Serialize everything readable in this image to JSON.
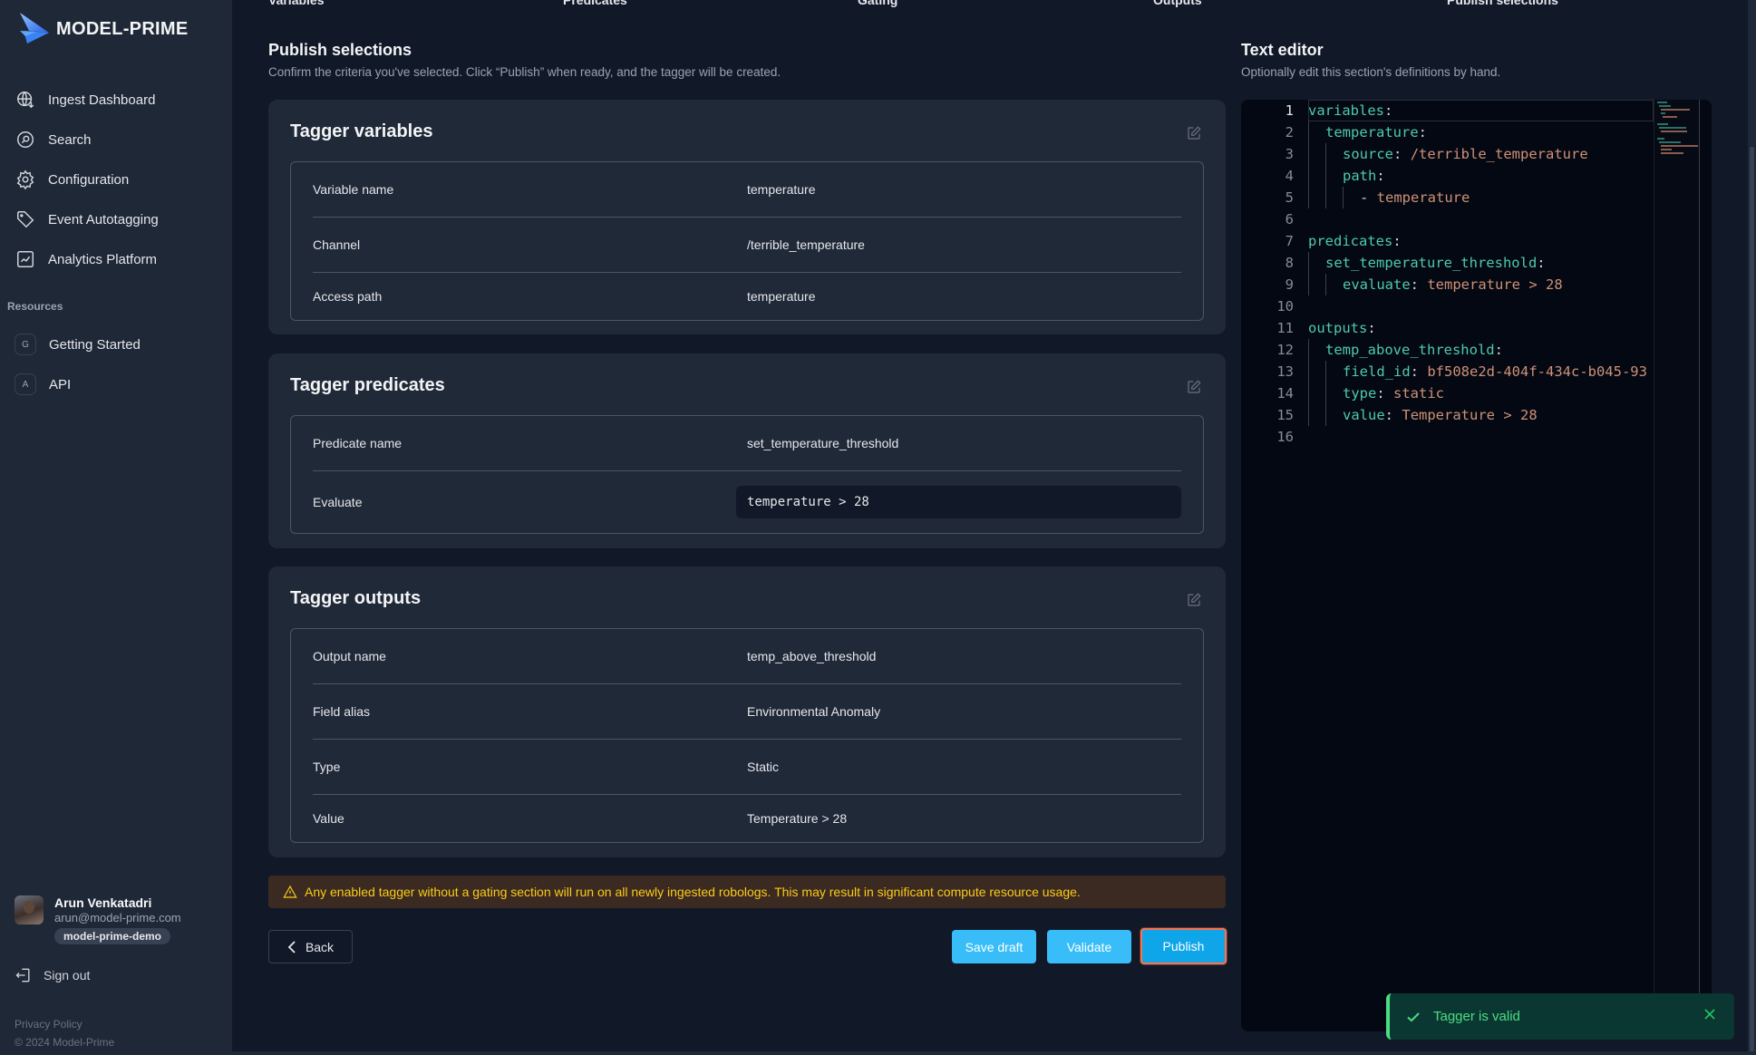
{
  "app": {
    "brand": "MODEL-PRIME"
  },
  "sidebar": {
    "nav": [
      {
        "label": "Ingest Dashboard",
        "icon": "globe-download-icon"
      },
      {
        "label": "Search",
        "icon": "search-icon"
      },
      {
        "label": "Configuration",
        "icon": "gear-icon"
      },
      {
        "label": "Event Autotagging",
        "icon": "tag-icon"
      },
      {
        "label": "Analytics Platform",
        "icon": "chart-icon"
      }
    ],
    "resources_label": "Resources",
    "resources": [
      {
        "badge": "G",
        "label": "Getting Started"
      },
      {
        "badge": "A",
        "label": "API"
      }
    ],
    "user": {
      "name": "Arun Venkatadri",
      "email": "arun@model-prime.com",
      "org": "model-prime-demo"
    },
    "sign_out": "Sign out",
    "privacy": "Privacy Policy",
    "copyright": "© 2024 Model-Prime"
  },
  "stepper": [
    "Variables",
    "Predicates",
    "Gating",
    "Outputs",
    "Publish selections"
  ],
  "main": {
    "title": "Publish selections",
    "subtitle": "Confirm the criteria you've selected. Click “Publish” when ready, and the tagger will be created.",
    "cards": [
      {
        "title": "Tagger variables",
        "rows": [
          {
            "key": "Variable name",
            "value": "temperature"
          },
          {
            "key": "Channel",
            "value": "/terrible_temperature"
          },
          {
            "key": "Access path",
            "value": "temperature"
          }
        ]
      },
      {
        "title": "Tagger predicates",
        "rows": [
          {
            "key": "Predicate name",
            "value": "set_temperature_threshold"
          },
          {
            "key": "Evaluate",
            "value": "temperature > 28",
            "code": true
          }
        ]
      },
      {
        "title": "Tagger outputs",
        "rows": [
          {
            "key": "Output name",
            "value": "temp_above_threshold"
          },
          {
            "key": "Field alias",
            "value": "Environmental Anomaly"
          },
          {
            "key": "Type",
            "value": "Static"
          },
          {
            "key": "Value",
            "value": "Temperature > 28"
          }
        ]
      }
    ],
    "warning": "Any enabled tagger without a gating section will run on all newly ingested robologs. This may result in significant compute resource usage.",
    "buttons": {
      "back": "Back",
      "save_draft": "Save draft",
      "validate": "Validate",
      "publish": "Publish"
    }
  },
  "editor": {
    "title": "Text editor",
    "subtitle": "Optionally edit this section's definitions by hand.",
    "lines": [
      {
        "indent": 0,
        "key": "variables",
        "value": ""
      },
      {
        "indent": 1,
        "key": "temperature",
        "value": ""
      },
      {
        "indent": 2,
        "key": "source",
        "value": "/terrible_temperature"
      },
      {
        "indent": 2,
        "key": "path",
        "value": ""
      },
      {
        "indent": 3,
        "key": "",
        "value": "- temperature"
      },
      {
        "indent": 0,
        "key": "",
        "value": ""
      },
      {
        "indent": 0,
        "key": "predicates",
        "value": ""
      },
      {
        "indent": 1,
        "key": "set_temperature_threshold",
        "value": ""
      },
      {
        "indent": 2,
        "key": "evaluate",
        "value": "temperature > 28"
      },
      {
        "indent": 0,
        "key": "",
        "value": ""
      },
      {
        "indent": 0,
        "key": "outputs",
        "value": ""
      },
      {
        "indent": 1,
        "key": "temp_above_threshold",
        "value": ""
      },
      {
        "indent": 2,
        "key": "field_id",
        "value": "bf508e2d-404f-434c-b045-93"
      },
      {
        "indent": 2,
        "key": "type",
        "value": "static"
      },
      {
        "indent": 2,
        "key": "value",
        "value": "Temperature > 28"
      },
      {
        "indent": 0,
        "key": "",
        "value": ""
      }
    ],
    "active_line": 1
  },
  "toast": {
    "message": "Tagger is valid",
    "status_color": "#4ade80"
  }
}
